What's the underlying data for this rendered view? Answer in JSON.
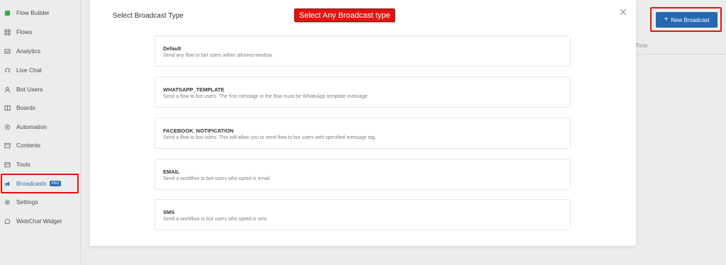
{
  "sidebar": {
    "items": [
      {
        "label": "Flow Builder",
        "icon": "flow-builder-icon"
      },
      {
        "label": "Flows",
        "icon": "flows-icon"
      },
      {
        "label": "Analytics",
        "icon": "analytics-icon"
      },
      {
        "label": "Live Chat",
        "icon": "headset-icon"
      },
      {
        "label": "Bot Users",
        "icon": "user-icon"
      },
      {
        "label": "Boards",
        "icon": "boards-icon"
      },
      {
        "label": "Automation",
        "icon": "automation-icon"
      },
      {
        "label": "Contents",
        "icon": "contents-icon"
      },
      {
        "label": "Tools",
        "icon": "tools-icon"
      },
      {
        "label": "Broadcasts",
        "icon": "megaphone-icon",
        "badge": "PRO"
      },
      {
        "label": "Settings",
        "icon": "gear-icon"
      },
      {
        "label": "WebChat Widget",
        "icon": "chat-widget-icon"
      }
    ]
  },
  "main": {
    "new_broadcast_label": "New Broadcast",
    "table_header_time": "Time"
  },
  "modal": {
    "title": "Select Broadcast Type",
    "annotation": "Select Any Broadcast type",
    "options": [
      {
        "title": "Default",
        "description": "Send any flow to bot users within allowed window."
      },
      {
        "title": "WHATSAPP_TEMPLATE",
        "description": "Send a flow to bot users. The first message in the flow must be WhatsApp template message"
      },
      {
        "title": "FACEBOOK_NOTIFICATION",
        "description": "Send a flow to bot users. This will allow you to send flow to bot users with specified message tag."
      },
      {
        "title": "EMAIL",
        "description": "Send a workflow to bot users who opted in email"
      },
      {
        "title": "SMS",
        "description": "Send a workflow to bot users who opted in sms"
      }
    ]
  },
  "colors": {
    "accent": "#2468b0",
    "highlight": "#e3140f",
    "active_nav": "#2d6fb3"
  }
}
